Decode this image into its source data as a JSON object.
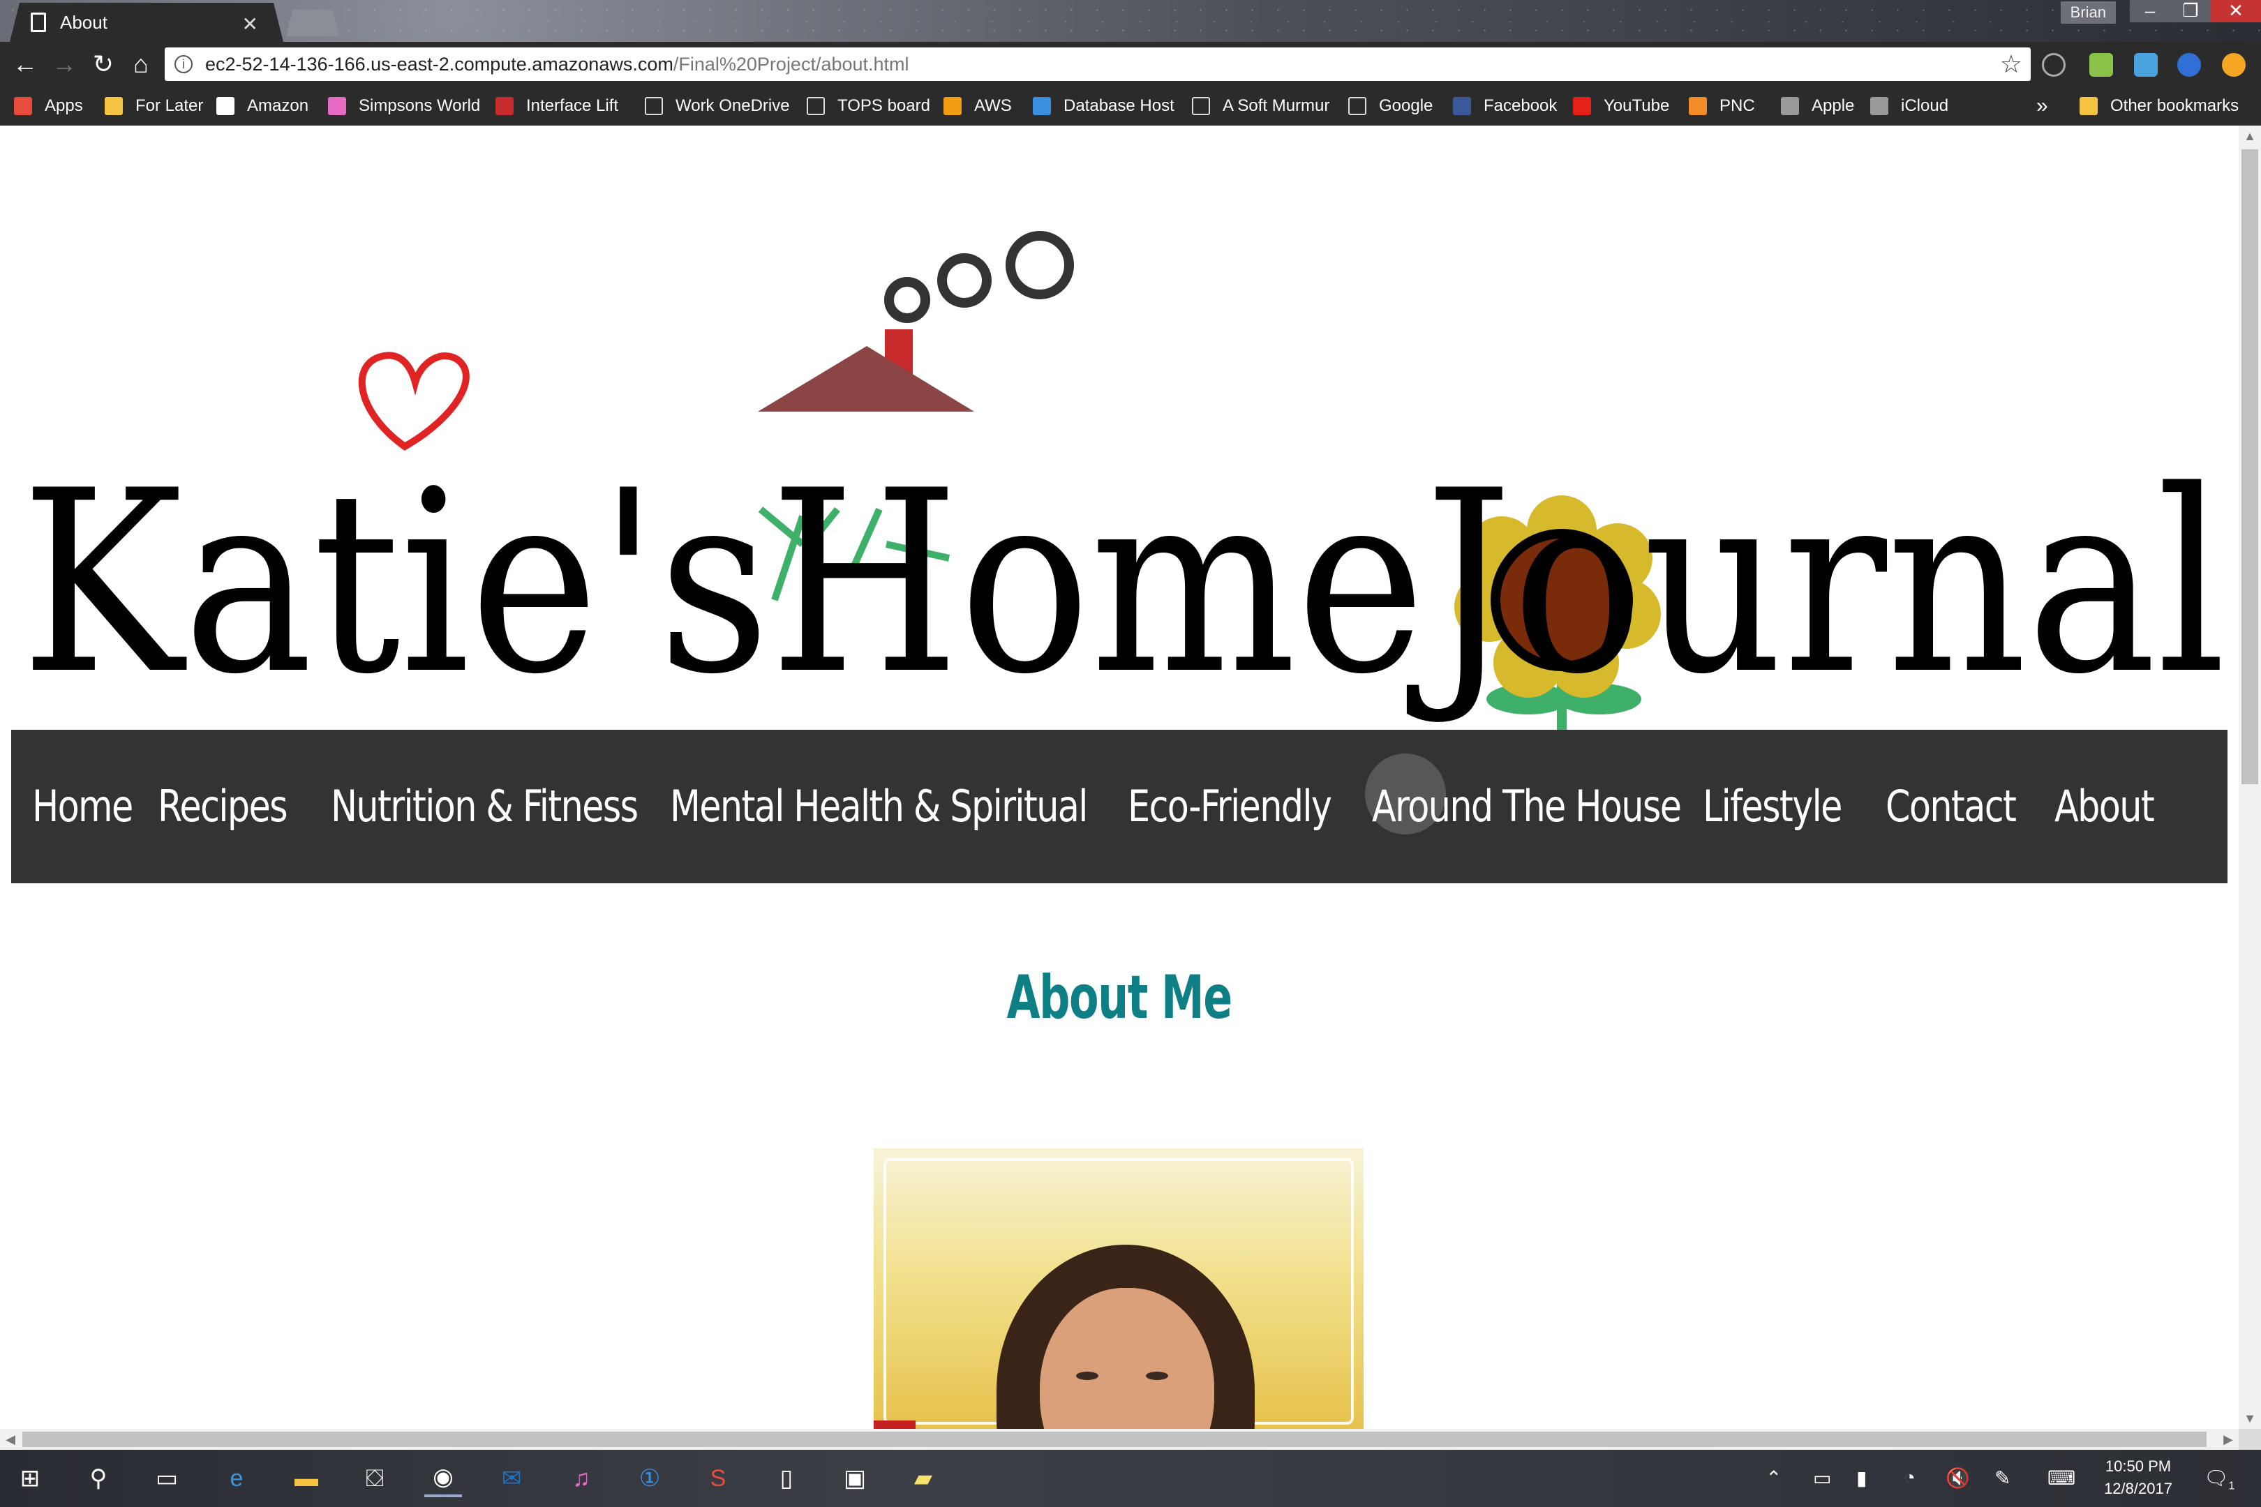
{
  "browser": {
    "tab_title": "About",
    "user_name": "Brian",
    "url_host": "ec2-52-14-136-166.us-east-2.compute.amazonaws.com",
    "url_path": "/Final%20Project/about.html",
    "bookmarks": [
      {
        "label": "Apps",
        "icon": "apps-grid-icon"
      },
      {
        "label": "For Later",
        "icon": "folder-icon"
      },
      {
        "label": "Amazon",
        "icon": "amazon-icon"
      },
      {
        "label": "Simpsons World",
        "icon": "donut-icon"
      },
      {
        "label": "Interface Lift",
        "icon": "interfacelift-icon"
      },
      {
        "label": "Work OneDrive",
        "icon": "page-icon"
      },
      {
        "label": "TOPS board",
        "icon": "page-icon"
      },
      {
        "label": "AWS",
        "icon": "aws-cube-icon"
      },
      {
        "label": "Database Host",
        "icon": "infinity-icon"
      },
      {
        "label": "A Soft Murmur",
        "icon": "page-icon"
      },
      {
        "label": "Google",
        "icon": "page-icon"
      },
      {
        "label": "Facebook",
        "icon": "facebook-icon"
      },
      {
        "label": "YouTube",
        "icon": "youtube-icon"
      },
      {
        "label": "PNC",
        "icon": "pnc-icon"
      },
      {
        "label": "Apple",
        "icon": "apple-icon"
      },
      {
        "label": "iCloud",
        "icon": "apple-icon"
      }
    ],
    "bookmarks_overflow": "»",
    "other_bookmarks": "Other bookmarks"
  },
  "site": {
    "logo_text": "Katie'sHomeJournal",
    "nav": [
      "Home",
      "Recipes",
      "Nutrition & Fitness",
      "Mental Health & Spiritual",
      "Eco-Friendly",
      "Around The House",
      "Lifestyle",
      "Contact",
      "About"
    ],
    "heading": "About Me",
    "colors": {
      "nav_bg": "#333333",
      "heading": "#0f7f86",
      "roof": "#8b4545",
      "heart": "#e02424",
      "sunflower_petals": "#d7b92c",
      "sunflower_center": "#7a2c0a",
      "stem": "#3fb06a"
    }
  },
  "taskbar": {
    "time": "10:50 PM",
    "date": "12/8/2017",
    "notifications": "1"
  }
}
